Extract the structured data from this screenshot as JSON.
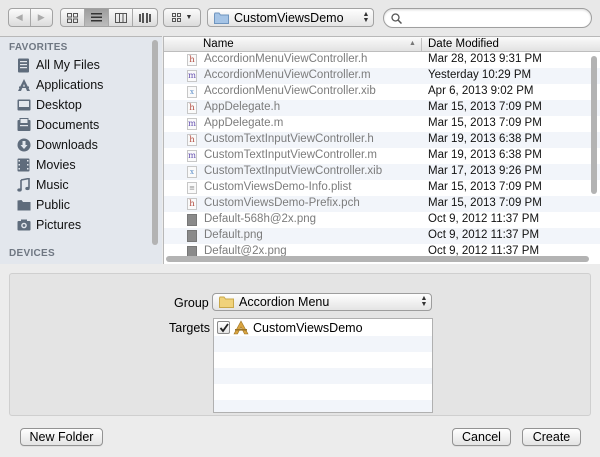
{
  "toolbar": {
    "location": "CustomViewsDemo",
    "search_placeholder": ""
  },
  "sidebar": {
    "favorites_heading": "FAVORITES",
    "devices_heading": "DEVICES",
    "items": [
      {
        "label": "All My Files",
        "icon": "all-files-icon"
      },
      {
        "label": "Applications",
        "icon": "applications-icon"
      },
      {
        "label": "Desktop",
        "icon": "desktop-icon"
      },
      {
        "label": "Documents",
        "icon": "documents-icon"
      },
      {
        "label": "Downloads",
        "icon": "downloads-icon"
      },
      {
        "label": "Movies",
        "icon": "movies-icon"
      },
      {
        "label": "Music",
        "icon": "music-icon"
      },
      {
        "label": "Public",
        "icon": "folder-icon"
      },
      {
        "label": "Pictures",
        "icon": "camera-icon"
      }
    ]
  },
  "filelist": {
    "columns": {
      "name": "Name",
      "date": "Date Modified"
    },
    "files": [
      {
        "name": "AccordionMenuViewController.h",
        "date": "Mar 28, 2013 9:31 PM",
        "type": "h"
      },
      {
        "name": "AccordionMenuViewController.m",
        "date": "Yesterday 10:29 PM",
        "type": "m"
      },
      {
        "name": "AccordionMenuViewController.xib",
        "date": "Apr 6, 2013 9:02 PM",
        "type": "xib"
      },
      {
        "name": "AppDelegate.h",
        "date": "Mar 15, 2013 7:09 PM",
        "type": "h"
      },
      {
        "name": "AppDelegate.m",
        "date": "Mar 15, 2013 7:09 PM",
        "type": "m"
      },
      {
        "name": "CustomTextInputViewController.h",
        "date": "Mar 19, 2013 6:38 PM",
        "type": "h"
      },
      {
        "name": "CustomTextInputViewController.m",
        "date": "Mar 19, 2013 6:38 PM",
        "type": "m"
      },
      {
        "name": "CustomTextInputViewController.xib",
        "date": "Mar 17, 2013 9:26 PM",
        "type": "xib"
      },
      {
        "name": "CustomViewsDemo-Info.plist",
        "date": "Mar 15, 2013 7:09 PM",
        "type": "plist"
      },
      {
        "name": "CustomViewsDemo-Prefix.pch",
        "date": "Mar 15, 2013 7:09 PM",
        "type": "pch"
      },
      {
        "name": "Default-568h@2x.png",
        "date": "Oct 9, 2012 11:37 PM",
        "type": "png"
      },
      {
        "name": "Default.png",
        "date": "Oct 9, 2012 11:37 PM",
        "type": "png"
      },
      {
        "name": "Default@2x.png",
        "date": "Oct 9, 2012 11:37 PM",
        "type": "png"
      }
    ]
  },
  "options": {
    "group_label": "Group",
    "group_value": "Accordion Menu",
    "targets_label": "Targets",
    "target_name": "CustomViewsDemo",
    "target_checked": true
  },
  "buttons": {
    "new_folder": "New Folder",
    "cancel": "Cancel",
    "create": "Create"
  }
}
